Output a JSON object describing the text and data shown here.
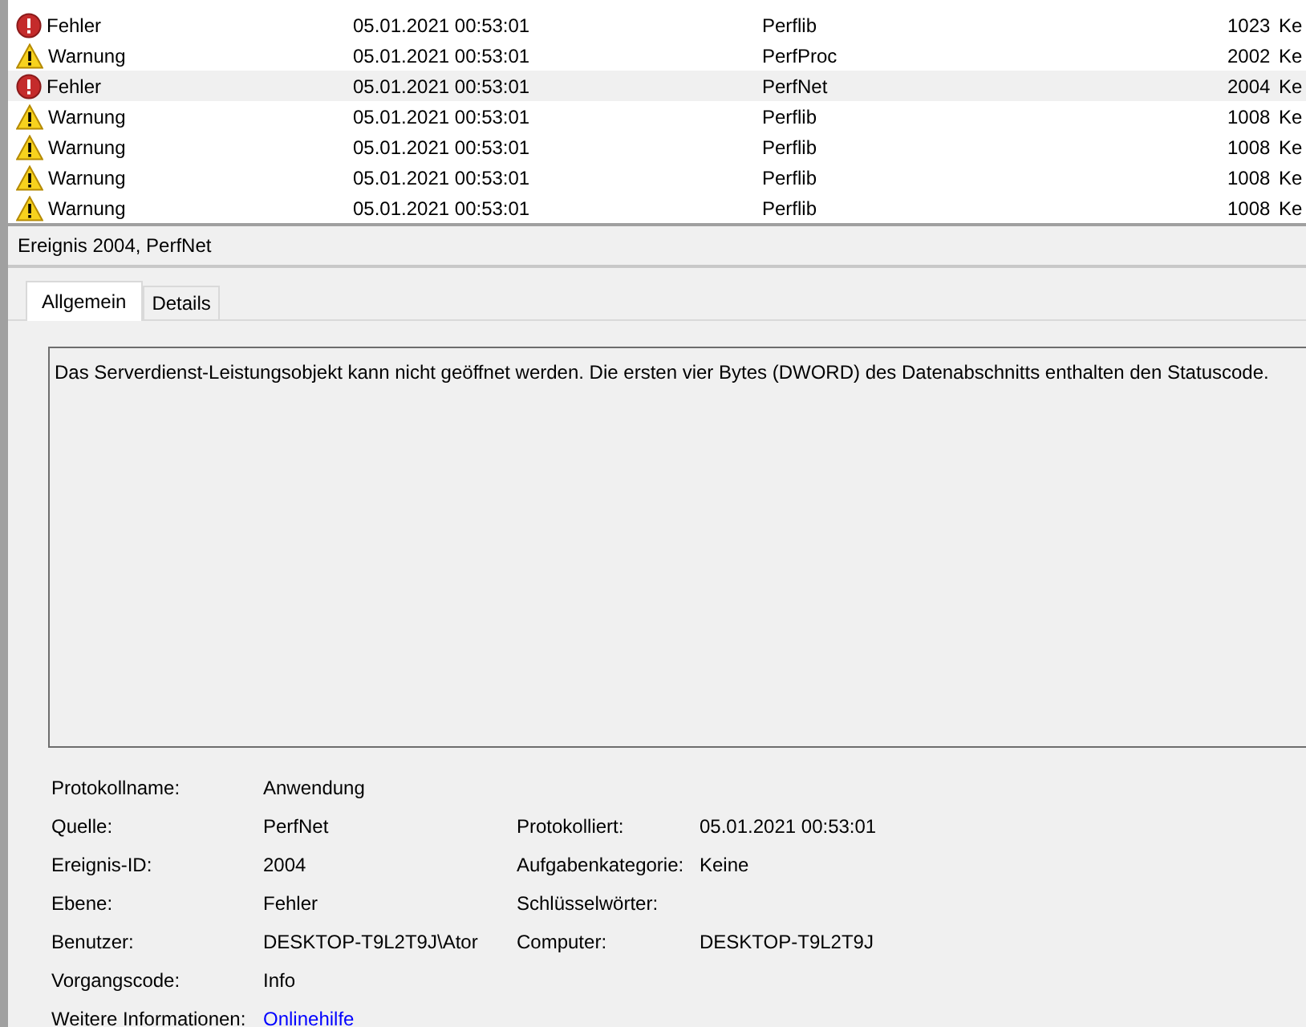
{
  "events": [
    {
      "level": {
        "kind": "error",
        "label": "Fehler"
      },
      "date": "05.01.2021 00:53:01",
      "source": "Perflib",
      "id": "1023",
      "column_5": "Ke",
      "selected": false
    },
    {
      "level": {
        "kind": "warning",
        "label": "Warnung"
      },
      "date": "05.01.2021 00:53:01",
      "source": "PerfProc",
      "id": "2002",
      "column_5": "Ke",
      "selected": false
    },
    {
      "level": {
        "kind": "error",
        "label": "Fehler"
      },
      "date": "05.01.2021 00:53:01",
      "source": "PerfNet",
      "id": "2004",
      "column_5": "Ke",
      "selected": true
    },
    {
      "level": {
        "kind": "warning",
        "label": "Warnung"
      },
      "date": "05.01.2021 00:53:01",
      "source": "Perflib",
      "id": "1008",
      "column_5": "Ke",
      "selected": false
    },
    {
      "level": {
        "kind": "warning",
        "label": "Warnung"
      },
      "date": "05.01.2021 00:53:01",
      "source": "Perflib",
      "id": "1008",
      "column_5": "Ke",
      "selected": false
    },
    {
      "level": {
        "kind": "warning",
        "label": "Warnung"
      },
      "date": "05.01.2021 00:53:01",
      "source": "Perflib",
      "id": "1008",
      "column_5": "Ke",
      "selected": false
    },
    {
      "level": {
        "kind": "warning",
        "label": "Warnung"
      },
      "date": "05.01.2021 00:53:01",
      "source": "Perflib",
      "id": "1008",
      "column_5": "Ke",
      "selected": false
    }
  ],
  "detail": {
    "title": "Ereignis 2004, PerfNet",
    "tabs": [
      {
        "label": "Allgemein",
        "selected": true
      },
      {
        "label": "Details",
        "selected": false
      }
    ],
    "message": "Das Serverdienst-Leistungsobjekt kann nicht geöffnet werden. Die ersten vier Bytes (DWORD) des Datenabschnitts enthalten den Statuscode.",
    "properties": [
      [
        {
          "label": "Protokollname:",
          "value": "Anwendung"
        }
      ],
      [
        {
          "label": "Quelle:",
          "value": "PerfNet"
        },
        {
          "label": "Protokolliert:",
          "value": "05.01.2021 00:53:01"
        }
      ],
      [
        {
          "label": "Ereignis-ID:",
          "value": "2004"
        },
        {
          "label": "Aufgabenkategorie:",
          "value": "Keine"
        }
      ],
      [
        {
          "label": "Ebene:",
          "value": "Fehler"
        },
        {
          "label": "Schlüsselwörter:"
        }
      ],
      [
        {
          "label": "Benutzer:",
          "value": "DESKTOP-T9L2T9J\\Ator"
        },
        {
          "label": "Computer:",
          "value": "DESKTOP-T9L2T9J"
        }
      ],
      [
        {
          "label": "Vorgangscode:",
          "value": "Info"
        }
      ]
    ],
    "more_info": {
      "label": "Weitere Informationen:",
      "link": "Onlinehilfe"
    }
  }
}
